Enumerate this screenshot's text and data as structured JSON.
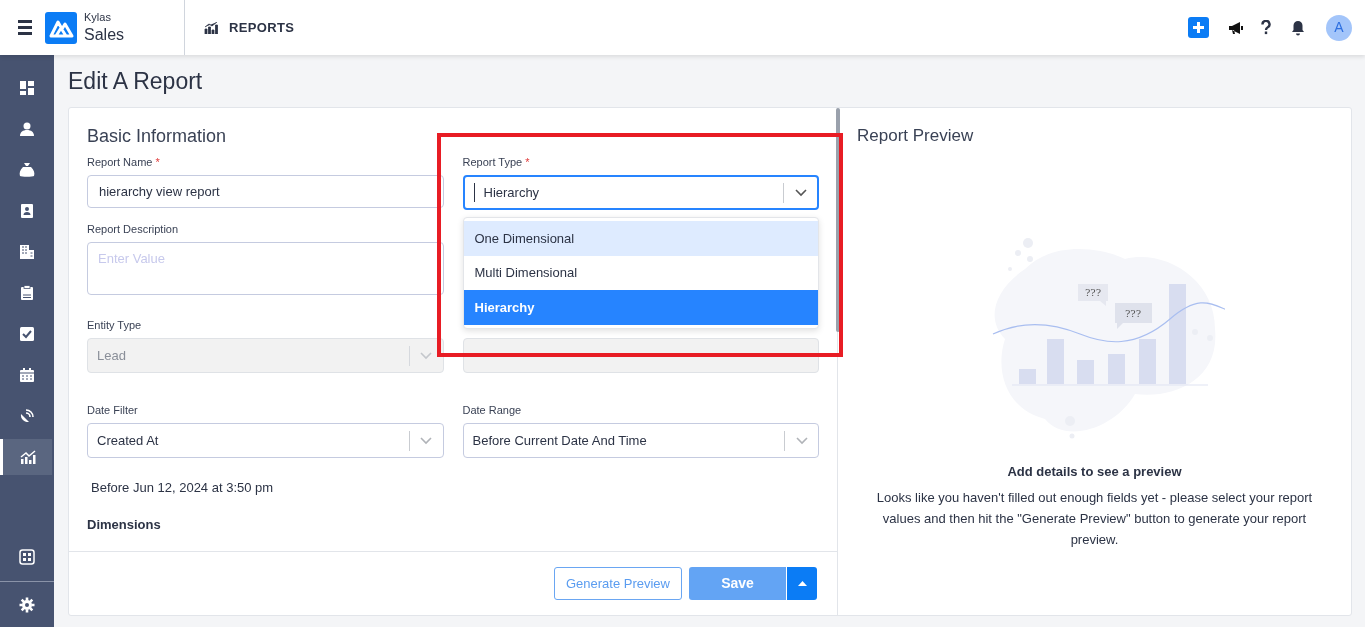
{
  "header": {
    "brand_small": "Kylas",
    "brand": "Sales",
    "module": "REPORTS",
    "avatar": "A"
  },
  "sidebar": {
    "items": [
      {
        "kind": "dashboard",
        "selected": false
      },
      {
        "kind": "person",
        "selected": false
      },
      {
        "kind": "moneybag",
        "selected": false
      },
      {
        "kind": "contact",
        "selected": false
      },
      {
        "kind": "building",
        "selected": false
      },
      {
        "kind": "clipboard",
        "selected": false
      },
      {
        "kind": "check",
        "selected": false
      },
      {
        "kind": "calendar",
        "selected": false
      },
      {
        "kind": "satellite",
        "selected": false
      },
      {
        "kind": "chart",
        "selected": true
      }
    ],
    "bottom_items": [
      {
        "kind": "apps",
        "selected": false
      },
      {
        "kind": "gear",
        "selected": false
      }
    ]
  },
  "page_title": "Edit A Report",
  "form": {
    "title": "Basic Information",
    "report_name": {
      "label": "Report Name",
      "required_mark": "*",
      "value": "hierarchy view report"
    },
    "report_type": {
      "label": "Report Type",
      "required_mark": "*",
      "value": "Hierarchy",
      "expanded": true,
      "options": [
        {
          "label": "One Dimensional",
          "selected": false,
          "hovered": true
        },
        {
          "label": "Multi Dimensional",
          "selected": false,
          "hovered": false
        },
        {
          "label": "Hierarchy",
          "selected": true,
          "hovered": false
        }
      ]
    },
    "report_description": {
      "label": "Report Description",
      "placeholder": "Enter Value"
    },
    "entity_type": {
      "label": "Entity Type",
      "value": "Lead",
      "disabled": true
    },
    "date_filter": {
      "label": "Date Filter",
      "value": "Created At"
    },
    "date_range": {
      "label": "Date Range",
      "value": "Before Current Date And Time"
    },
    "date_note": "Before Jun 12, 2024 at 3:50 pm",
    "dimensions_title": "Dimensions",
    "buttons": {
      "generate": "Generate Preview",
      "save": "Save"
    }
  },
  "preview": {
    "title": "Report Preview",
    "bubbles": [
      "???",
      "???"
    ],
    "empty_title": "Add details to see a preview",
    "empty_text": "Looks like you haven't filled out enough fields yet - please select your report values and then hit the \"Generate Preview\" button to generate your report preview."
  }
}
